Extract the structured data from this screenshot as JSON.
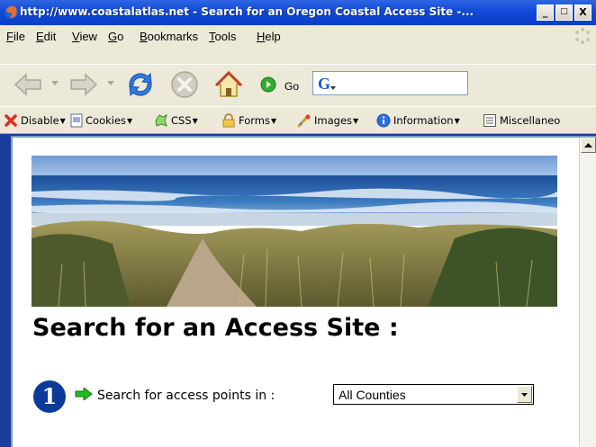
{
  "window": {
    "title": "http://www.coastalatlas.net - Search for an Oregon Coastal Access Site -...",
    "controls": {
      "minimize": "_",
      "maximize": "□",
      "close": "X"
    }
  },
  "menu": [
    "File",
    "Edit",
    "View",
    "Go",
    "Bookmarks",
    "Tools",
    "Help"
  ],
  "nav": {
    "go_label": "Go",
    "address_value": ""
  },
  "dev_toolbar": [
    {
      "label": "Disable",
      "icon": "no-icon"
    },
    {
      "label": "Cookies",
      "icon": "cookie-icon"
    },
    {
      "label": "CSS",
      "icon": "css-icon"
    },
    {
      "label": "Forms",
      "icon": "lock-icon"
    },
    {
      "label": "Images",
      "icon": "images-icon"
    },
    {
      "label": "Information",
      "icon": "info-icon"
    },
    {
      "label": "Miscellaneo",
      "icon": "misc-icon"
    }
  ],
  "page": {
    "heading": "Search for an Access Site :",
    "step_number": "1",
    "search_label": "Search for access points in :",
    "county_select": {
      "selected": "All Counties"
    }
  },
  "colors": {
    "titlebar": "#1148d6",
    "chrome": "#ece9d8",
    "step_circle": "#0c3a99",
    "arrow": "#22bb22"
  }
}
